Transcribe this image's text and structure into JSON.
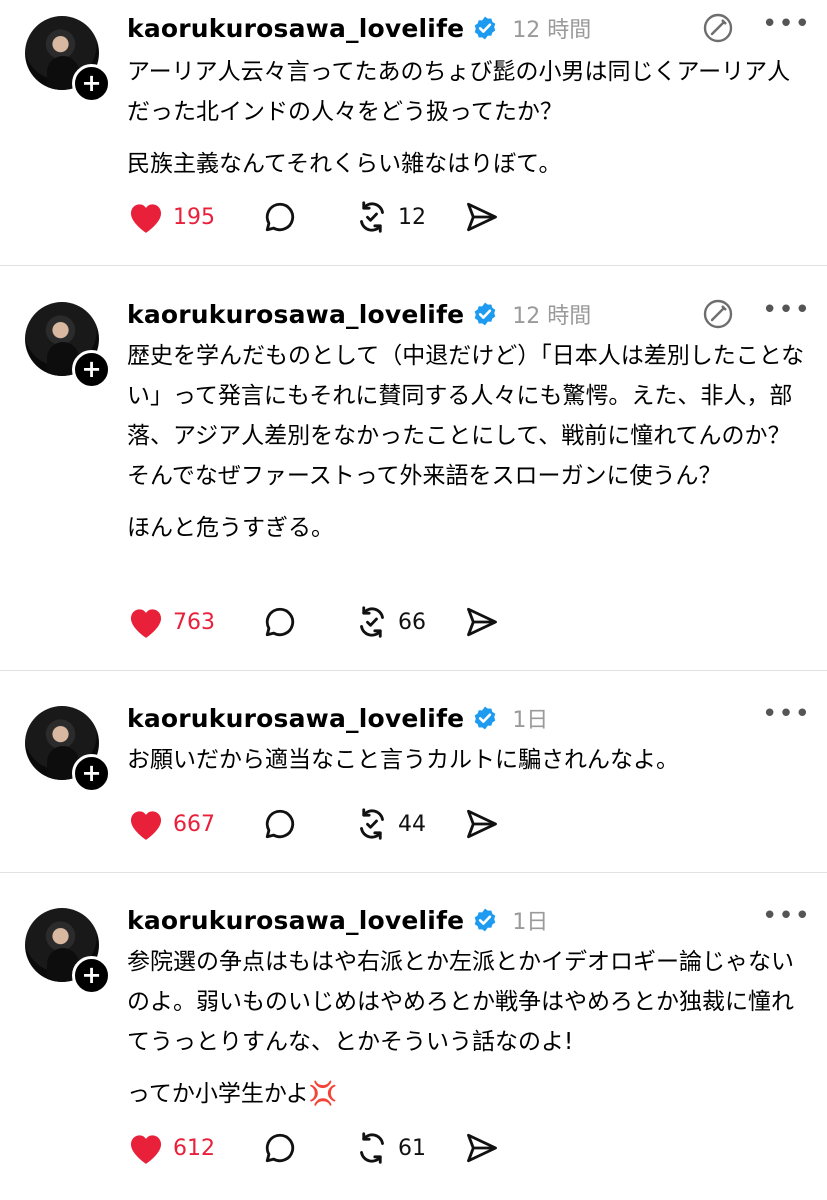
{
  "posts": [
    {
      "username": "kaorukurosawa_lovelife",
      "time": "12 時間",
      "paragraphs": [
        "アーリア人云々言ってたあのちょび髭の小男は同じくアーリア人だった北インドの人々をどう扱ってたか？",
        "民族主義なんてそれくらい雑なはりぼて。"
      ],
      "likes": "195",
      "reposts": "12",
      "show_compose": true
    },
    {
      "username": "kaorukurosawa_lovelife",
      "time": "12 時間",
      "paragraphs": [
        "歴史を学んだものとして（中退だけど）「日本人は差別したことない」って発言にもそれに賛同する人々にも驚愕。えた、非人，部落、アジア人差別をなかったことにして、戦前に憧れてんのか？そんでなぜファーストって外来語をスローガンに使うん？",
        "ほんと危うすぎる。"
      ],
      "likes": "763",
      "reposts": "66",
      "show_compose": true
    },
    {
      "username": "kaorukurosawa_lovelife",
      "time": "1日",
      "paragraphs": [
        "お願いだから適当なこと言うカルトに騙されんなよ。"
      ],
      "likes": "667",
      "reposts": "44",
      "show_compose": false
    },
    {
      "username": "kaorukurosawa_lovelife",
      "time": "1日",
      "paragraphs": [
        "参院選の争点はもはや右派とか左派とかイデオロギー論じゃないのよ。弱いものいじめはやめろとか戦争はやめろとか独裁に憧れてうっとりすんな、とかそういう話なのよ!",
        "ってか小学生かよ💢"
      ],
      "likes": "612",
      "reposts": "61",
      "show_compose": false
    }
  ],
  "icons": {
    "verified": "verified-badge-icon",
    "compose": "compose-icon",
    "more": "more-icon",
    "like": "heart-icon",
    "reply": "reply-icon",
    "repost": "repost-icon",
    "share": "share-icon",
    "follow": "plus-icon"
  },
  "colors": {
    "like": "#e8203a",
    "verified": "#1d9bf0",
    "time": "#9a9a9a",
    "divider": "#e2e2e2"
  }
}
